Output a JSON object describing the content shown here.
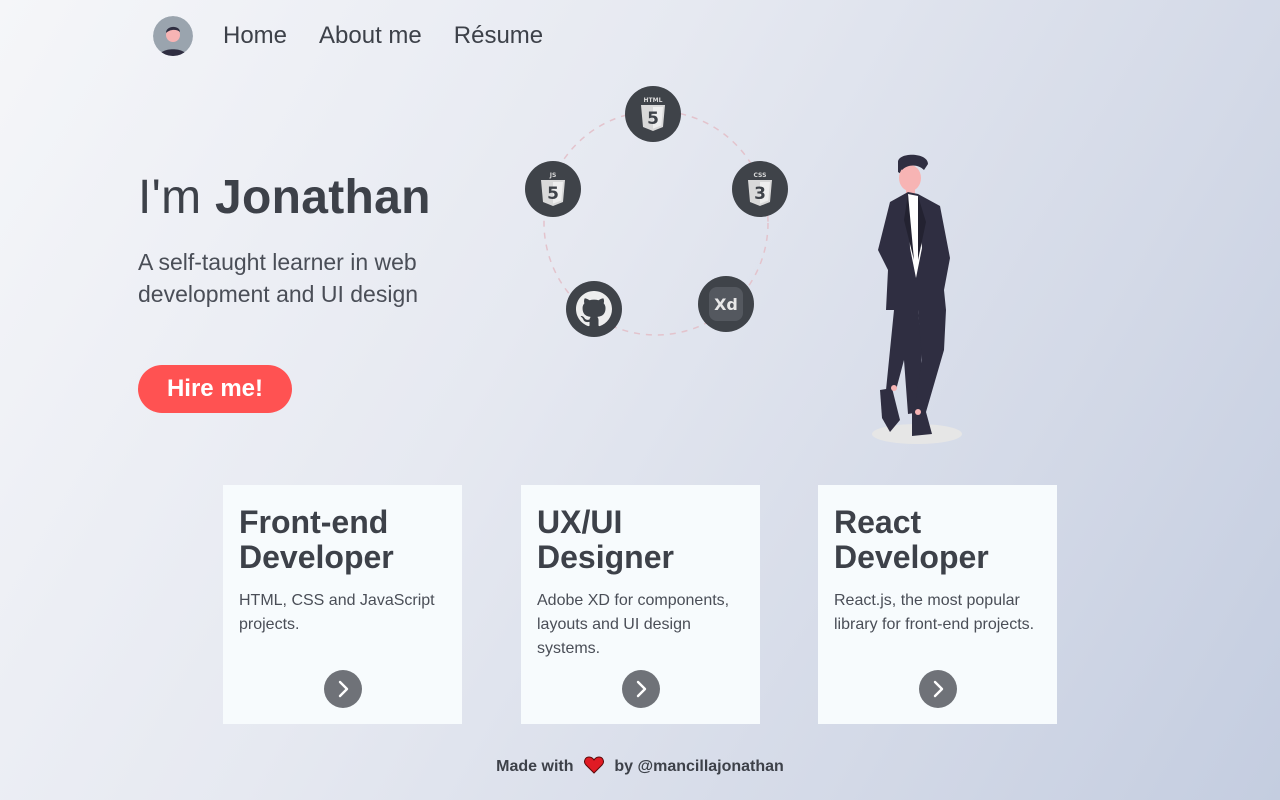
{
  "nav": {
    "avatar": "avatar",
    "links": [
      "Home",
      "About me",
      "Résume"
    ]
  },
  "hero": {
    "greeting": "I'm",
    "name": "Jonathan",
    "subtitle": "A self-taught learner in web development and UI design",
    "cta": "Hire me!"
  },
  "tech_icons": [
    {
      "icon": "html5-icon",
      "label": "HTML"
    },
    {
      "icon": "css3-icon",
      "label": "CSS"
    },
    {
      "icon": "javascript-icon",
      "label": "JS"
    },
    {
      "icon": "adobe-xd-icon",
      "label": "Xd"
    },
    {
      "icon": "github-icon"
    }
  ],
  "cards": [
    {
      "title": "Front-end Developer",
      "description": "HTML, CSS and JavaScript projects."
    },
    {
      "title": "UX/UI Designer",
      "description": "Adobe XD for components, layouts and UI design systems."
    },
    {
      "title": "React Developer",
      "description": "React.js, the most popular library for front-end projects."
    }
  ],
  "footer": {
    "before": "Made with",
    "after": "by @mancillajonathan"
  },
  "colors": {
    "accent": "#ff5252",
    "text": "#3d4149",
    "icon_bg": "#3f4349",
    "card_bg": "#f7fbfd"
  }
}
